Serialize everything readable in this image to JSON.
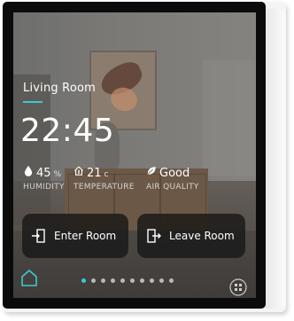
{
  "room": {
    "name": "Living Room"
  },
  "clock": {
    "time": "22:45"
  },
  "stats": {
    "humidity": {
      "value": "45",
      "unit": "%",
      "label": "HUMIDITY",
      "icon": "water-drop-icon"
    },
    "temperature": {
      "value": "21",
      "unit": "c",
      "label": "TEMPERATURE",
      "icon": "home-thermometer-icon"
    },
    "air_quality": {
      "value": "Good",
      "label": "AIR QUALITY",
      "icon": "leaf-icon"
    }
  },
  "actions": {
    "enter": {
      "label": "Enter Room",
      "icon": "enter-door-icon"
    },
    "leave": {
      "label": "Leave Room",
      "icon": "leave-door-icon"
    }
  },
  "pager": {
    "total_pages": 10,
    "active_index": 0
  },
  "colors": {
    "accent": "#3ec8d6",
    "button_bg": "#181818",
    "text": "#ffffff"
  }
}
